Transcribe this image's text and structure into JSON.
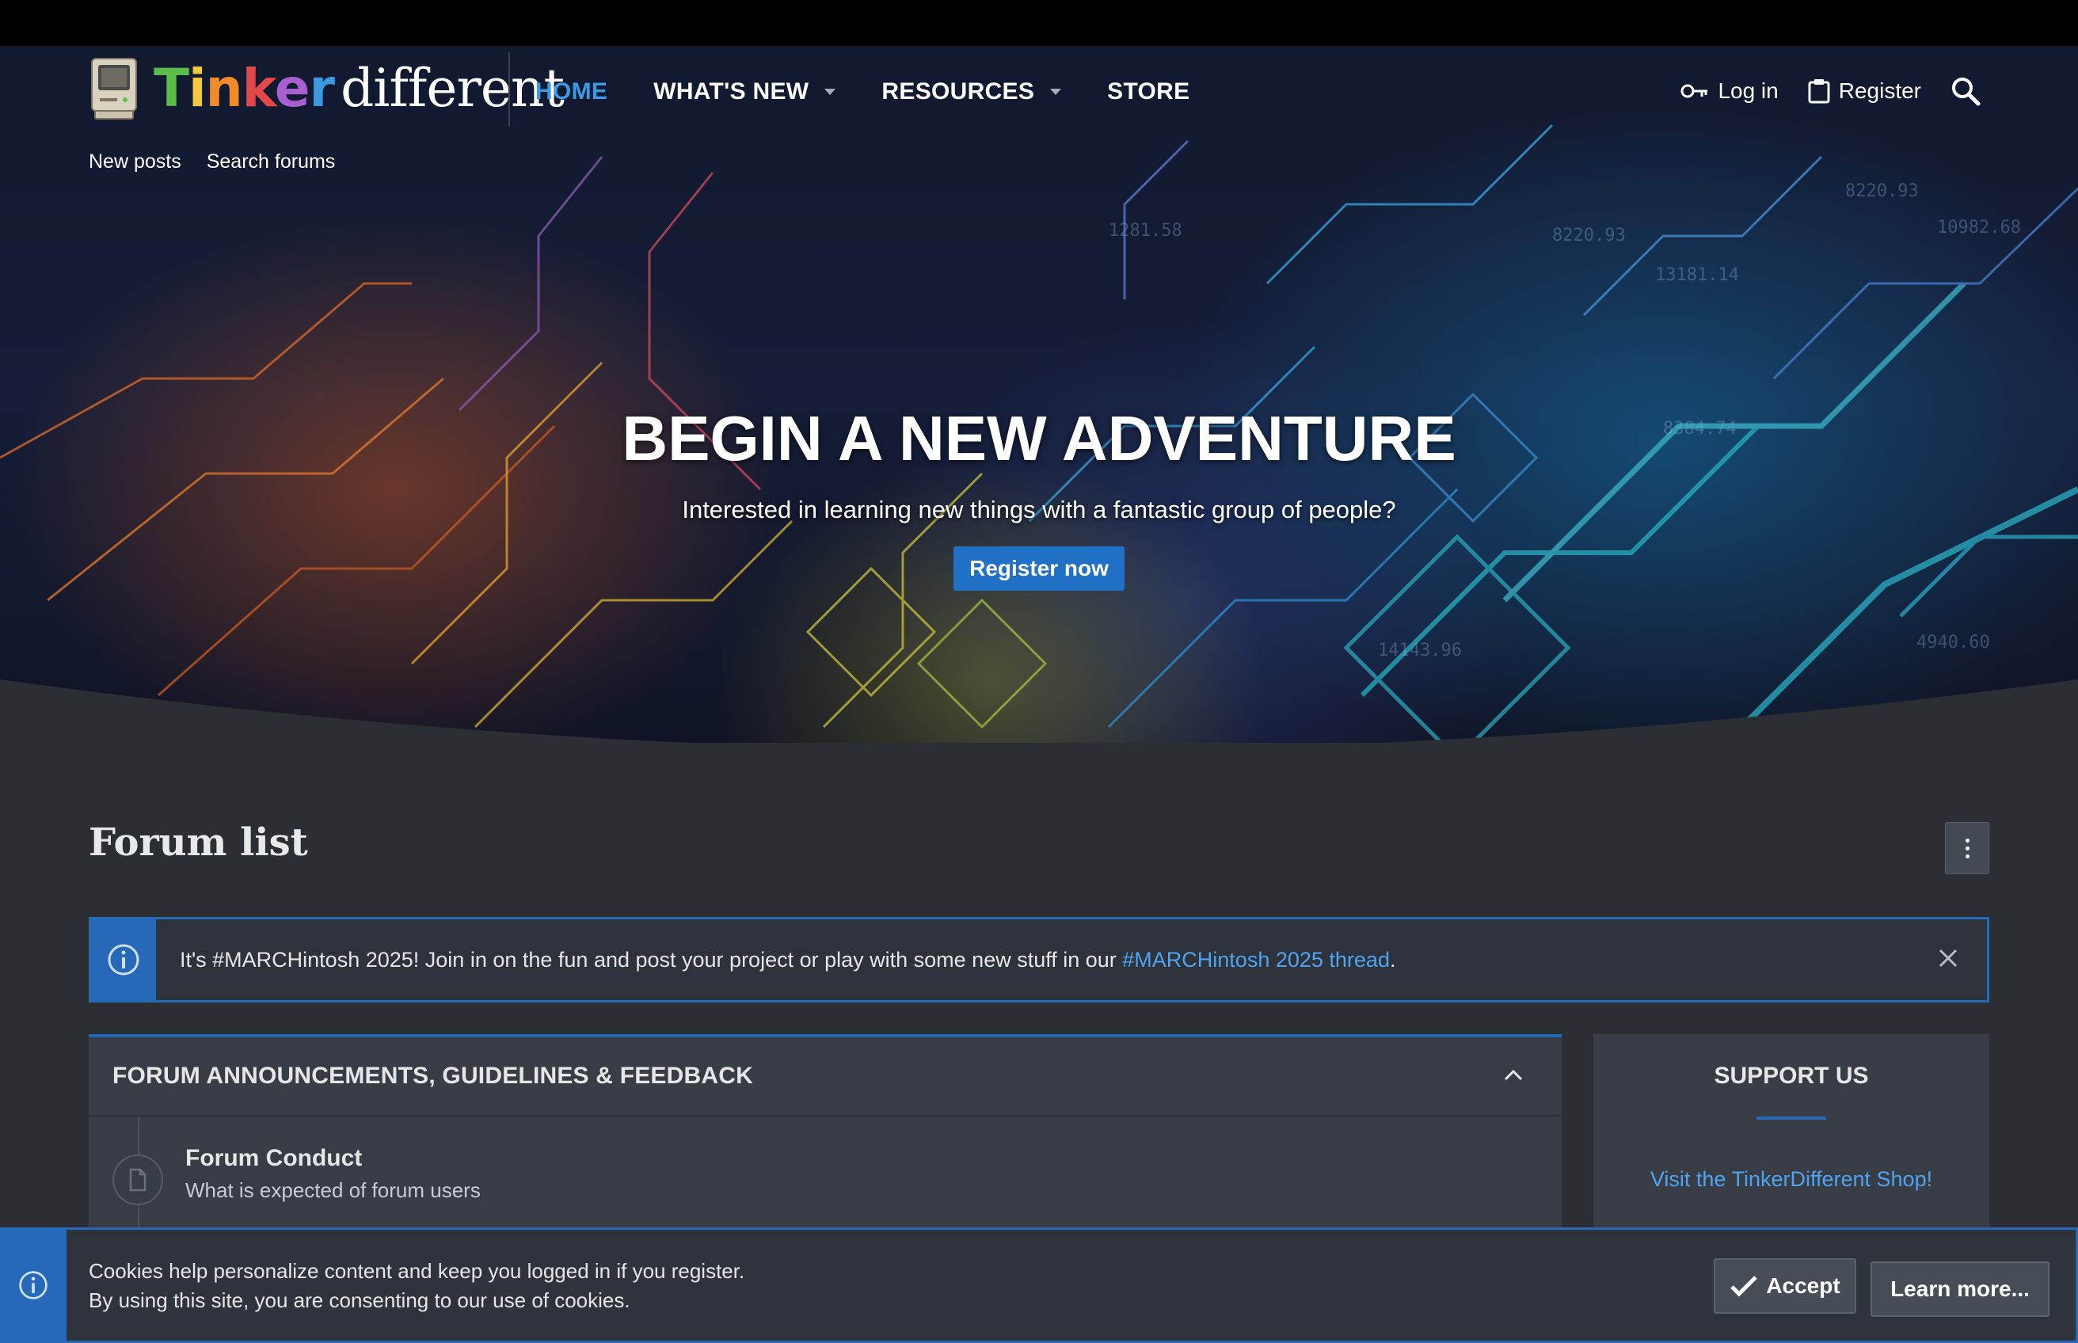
{
  "logo": {
    "tinker_letters": [
      {
        "ch": "T",
        "color": "#5bbd4a"
      },
      {
        "ch": "i",
        "color": "#f3c83b"
      },
      {
        "ch": "n",
        "color": "#f08b2a"
      },
      {
        "ch": "k",
        "color": "#e34848"
      },
      {
        "ch": "e",
        "color": "#a85fd0"
      },
      {
        "ch": "r",
        "color": "#3c98e0"
      }
    ],
    "different": "different"
  },
  "nav": {
    "items": [
      {
        "label": "HOME",
        "active": true,
        "dropdown": false
      },
      {
        "label": "WHAT'S NEW",
        "active": false,
        "dropdown": true
      },
      {
        "label": "RESOURCES",
        "active": false,
        "dropdown": true
      },
      {
        "label": "STORE",
        "active": false,
        "dropdown": false
      }
    ],
    "login": "Log in",
    "register": "Register",
    "login_icon": "key-icon",
    "register_icon": "clipboard-icon",
    "search_icon": "search-icon"
  },
  "subnav": [
    "New posts",
    "Search forums"
  ],
  "hero": {
    "title": "BEGIN A NEW ADVENTURE",
    "subtitle": "Interested in learning new things with a fantastic group of people?",
    "cta": "Register now"
  },
  "page": {
    "title": "Forum list"
  },
  "notice": {
    "text_before": "It's #MARCHintosh 2025! Join in on the fun and post your project or play with some new stuff in our ",
    "link": "#MARCHintosh 2025 thread",
    "text_after": "."
  },
  "forum_block": {
    "title": "FORUM ANNOUNCEMENTS, GUIDELINES & FEEDBACK",
    "nodes": [
      {
        "title": "Forum Conduct",
        "description": "What is expected of forum users"
      }
    ]
  },
  "sidebar": {
    "title": "SUPPORT US",
    "link": "Visit the TinkerDifferent Shop!"
  },
  "cookie": {
    "line1": "Cookies help personalize content and keep you logged in if you register.",
    "line2": "By using this site, you are consenting to our use of cookies.",
    "accept": "Accept",
    "learn_more": "Learn more..."
  },
  "colors": {
    "accent": "#2569b8",
    "link": "#4fa3f0",
    "active_nav": "#3f9ae6",
    "background": "#2b2e33"
  }
}
